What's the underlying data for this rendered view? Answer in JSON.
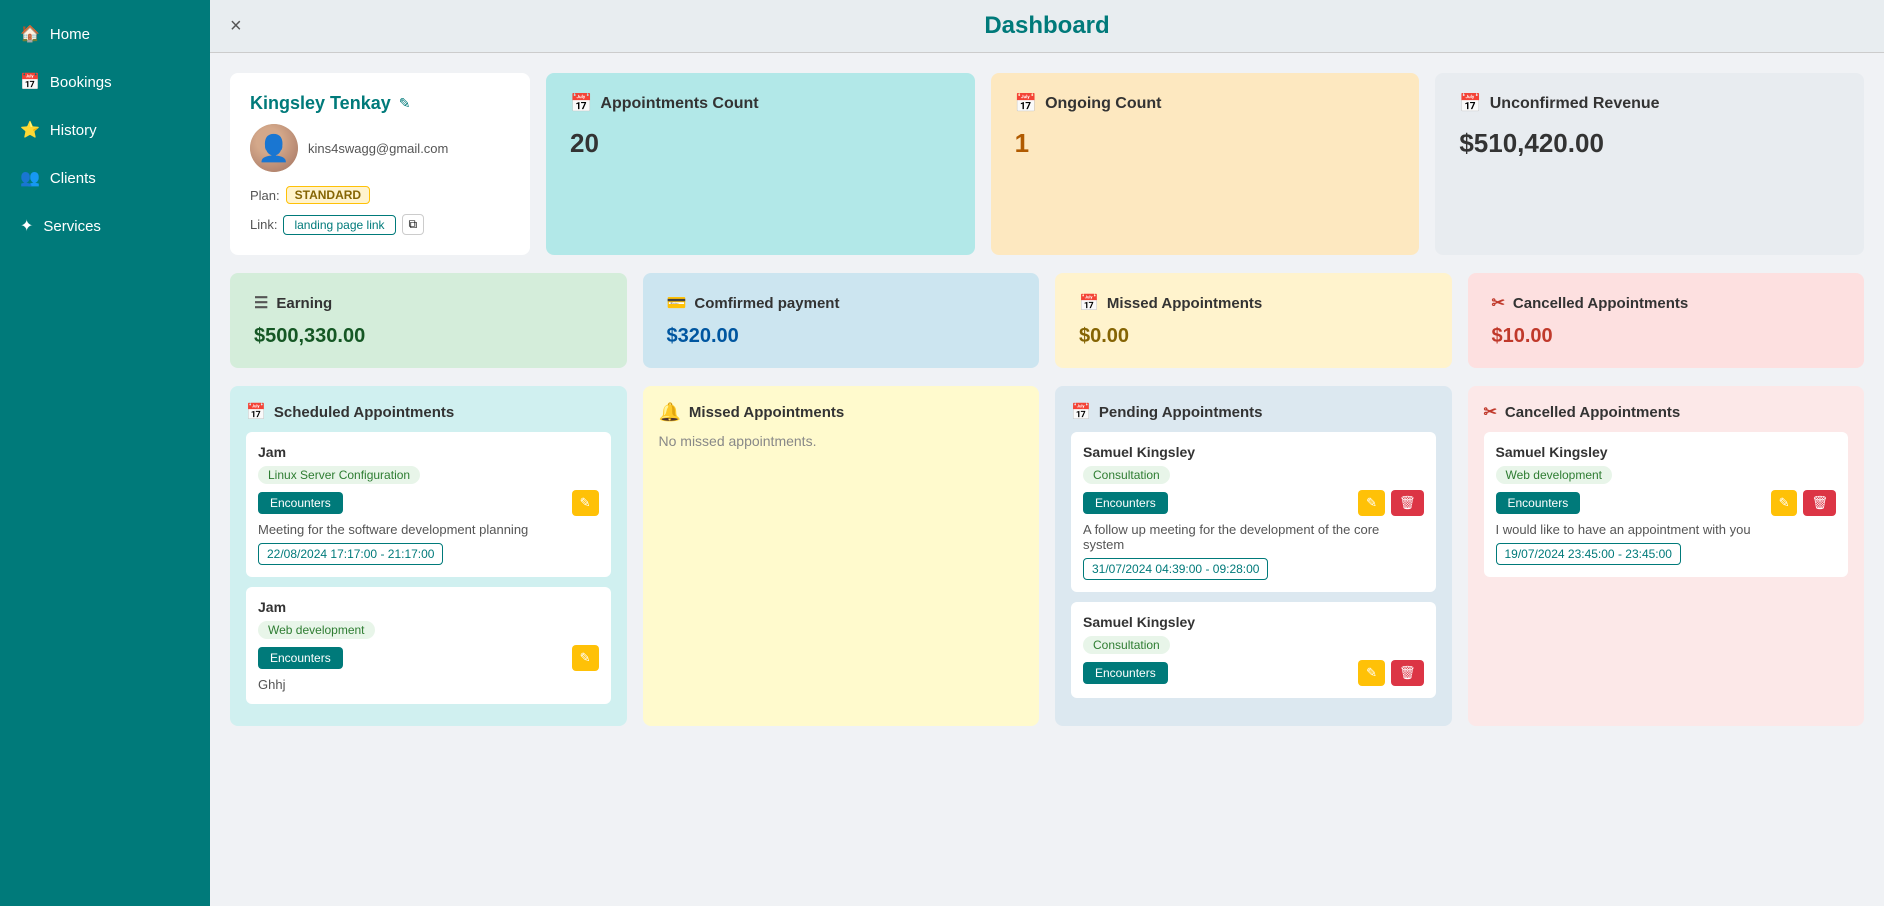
{
  "sidebar": {
    "items": [
      {
        "id": "home",
        "label": "Home",
        "icon": "🏠"
      },
      {
        "id": "bookings",
        "label": "Bookings",
        "icon": "📅"
      },
      {
        "id": "history",
        "label": "History",
        "icon": "⭐"
      },
      {
        "id": "clients",
        "label": "Clients",
        "icon": "👥"
      },
      {
        "id": "services",
        "label": "Services",
        "icon": "✦"
      }
    ]
  },
  "header": {
    "title": "Dashboard",
    "close_label": "×"
  },
  "profile": {
    "name": "Kingsley Tenkay",
    "email": "kins4swagg@gmail.com",
    "plan_label": "Plan:",
    "plan_value": "STANDARD",
    "link_label": "Link:",
    "link_text": "landing page link",
    "copy_icon": "⧉"
  },
  "stats": {
    "appointments": {
      "title": "Appointments Count",
      "icon": "📅",
      "value": "20"
    },
    "ongoing": {
      "title": "Ongoing Count",
      "icon": "📅",
      "value": "1"
    },
    "unconfirmed": {
      "title": "Unconfirmed Revenue",
      "icon": "📅",
      "value": "$510,420.00"
    }
  },
  "metrics": {
    "earning": {
      "title": "Earning",
      "icon": "☰",
      "value": "$500,330.00"
    },
    "confirmed_payment": {
      "title": "Comfirmed payment",
      "icon": "💳",
      "value": "$320.00"
    },
    "missed_appointments": {
      "title": "Missed Appointments",
      "icon": "📅",
      "value": "$0.00"
    },
    "cancelled_appointments": {
      "title": "Cancelled Appointments",
      "icon": "✂",
      "value": "$10.00"
    }
  },
  "scheduled_appointments": {
    "title": "Scheduled Appointments",
    "icon": "📅",
    "cards": [
      {
        "name": "Jam",
        "service": "Linux Server Configuration",
        "btn": "Encounters",
        "desc": "Meeting for the software development planning",
        "time": "22/08/2024 17:17:00 - 21:17:00",
        "has_edit": true
      },
      {
        "name": "Jam",
        "service": "Web development",
        "btn": "Encounters",
        "desc": "Ghhj",
        "time": "",
        "has_edit": true
      }
    ]
  },
  "missed_appointments": {
    "title": "Missed Appointments",
    "icon": "🔔",
    "no_appt_text": "No missed appointments."
  },
  "pending_appointments": {
    "title": "Pending Appointments",
    "icon": "📅",
    "cards": [
      {
        "name": "Samuel Kingsley",
        "service": "Consultation",
        "btn": "Encounters",
        "desc": "A follow up meeting for the development of the core system",
        "time": "31/07/2024 04:39:00 - 09:28:00",
        "has_edit": true,
        "has_delete": true
      },
      {
        "name": "Samuel Kingsley",
        "service": "Consultation",
        "btn": "Encounters",
        "desc": "",
        "time": "",
        "has_edit": true,
        "has_delete": true
      }
    ]
  },
  "cancelled_appointments_section": {
    "title": "Cancelled Appointments",
    "icon": "✂",
    "cards": [
      {
        "name": "Samuel Kingsley",
        "service": "Web development",
        "btn": "Encounters",
        "desc": "I would like to have an appointment with you",
        "time": "19/07/2024 23:45:00 - 23:45:00",
        "has_edit": true,
        "has_delete": true
      }
    ]
  }
}
